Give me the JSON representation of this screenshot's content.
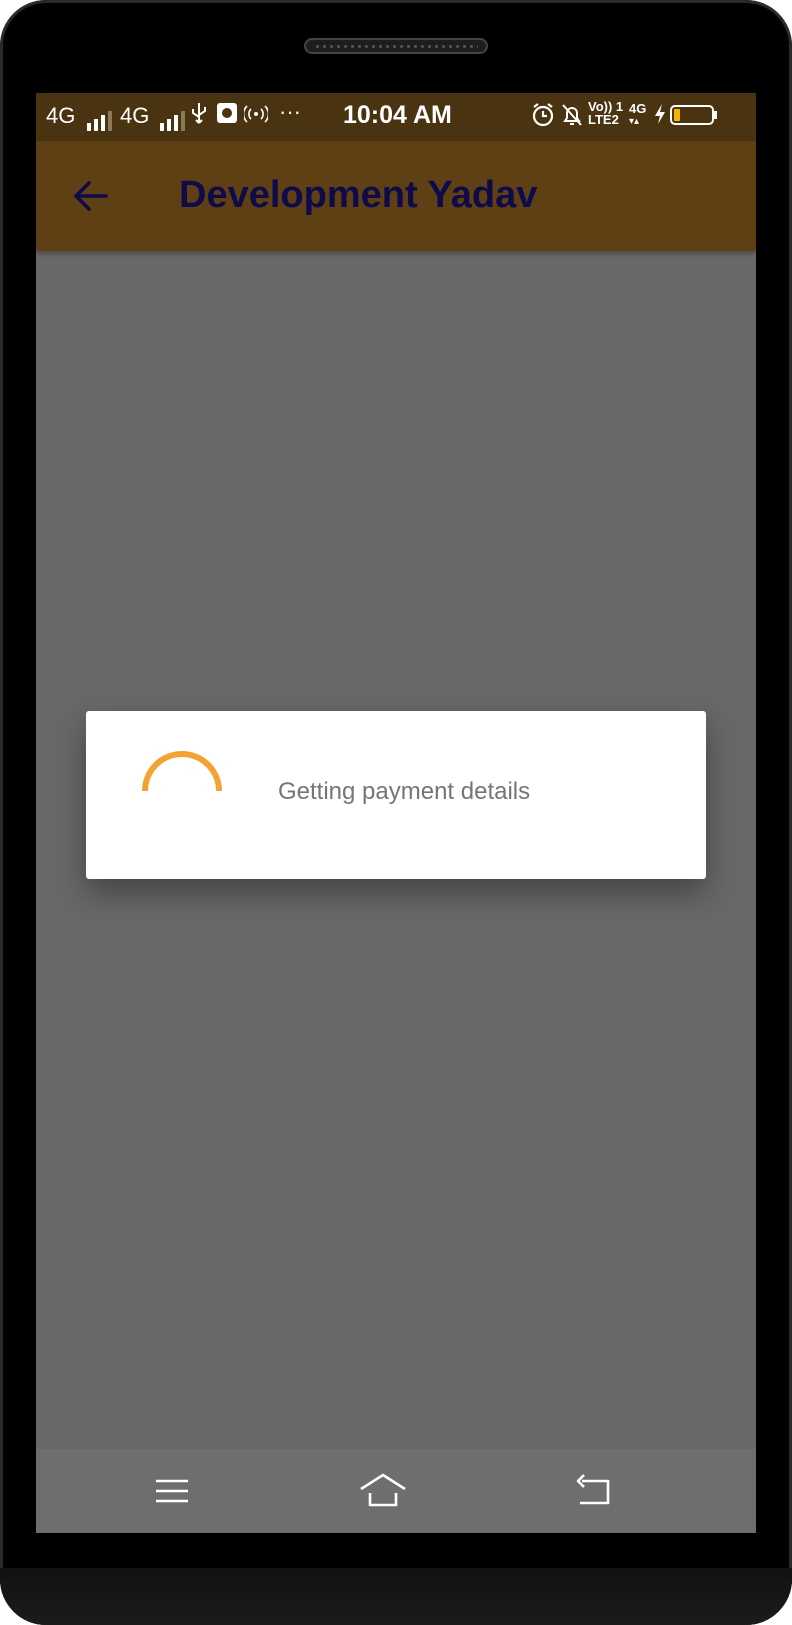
{
  "statusbar": {
    "net1": "4G",
    "net2": "4G",
    "overflow": "···",
    "time": "10:04 AM",
    "volte_line1": "Vo)) 1",
    "volte_line2": "LTE2",
    "net3": "4G"
  },
  "appbar": {
    "title": "Development Yadav"
  },
  "dialog": {
    "message": "Getting payment details",
    "spinner_color": "#f4a234"
  },
  "colors": {
    "statusbar": "#4a3310",
    "appbar": "#5e4014",
    "title": "#0f0a4a",
    "scrim": "#686868"
  },
  "icons": {
    "back": "arrow-left-icon",
    "menu": "menu-icon",
    "home": "home-icon",
    "back_nav": "back-nav-icon"
  }
}
